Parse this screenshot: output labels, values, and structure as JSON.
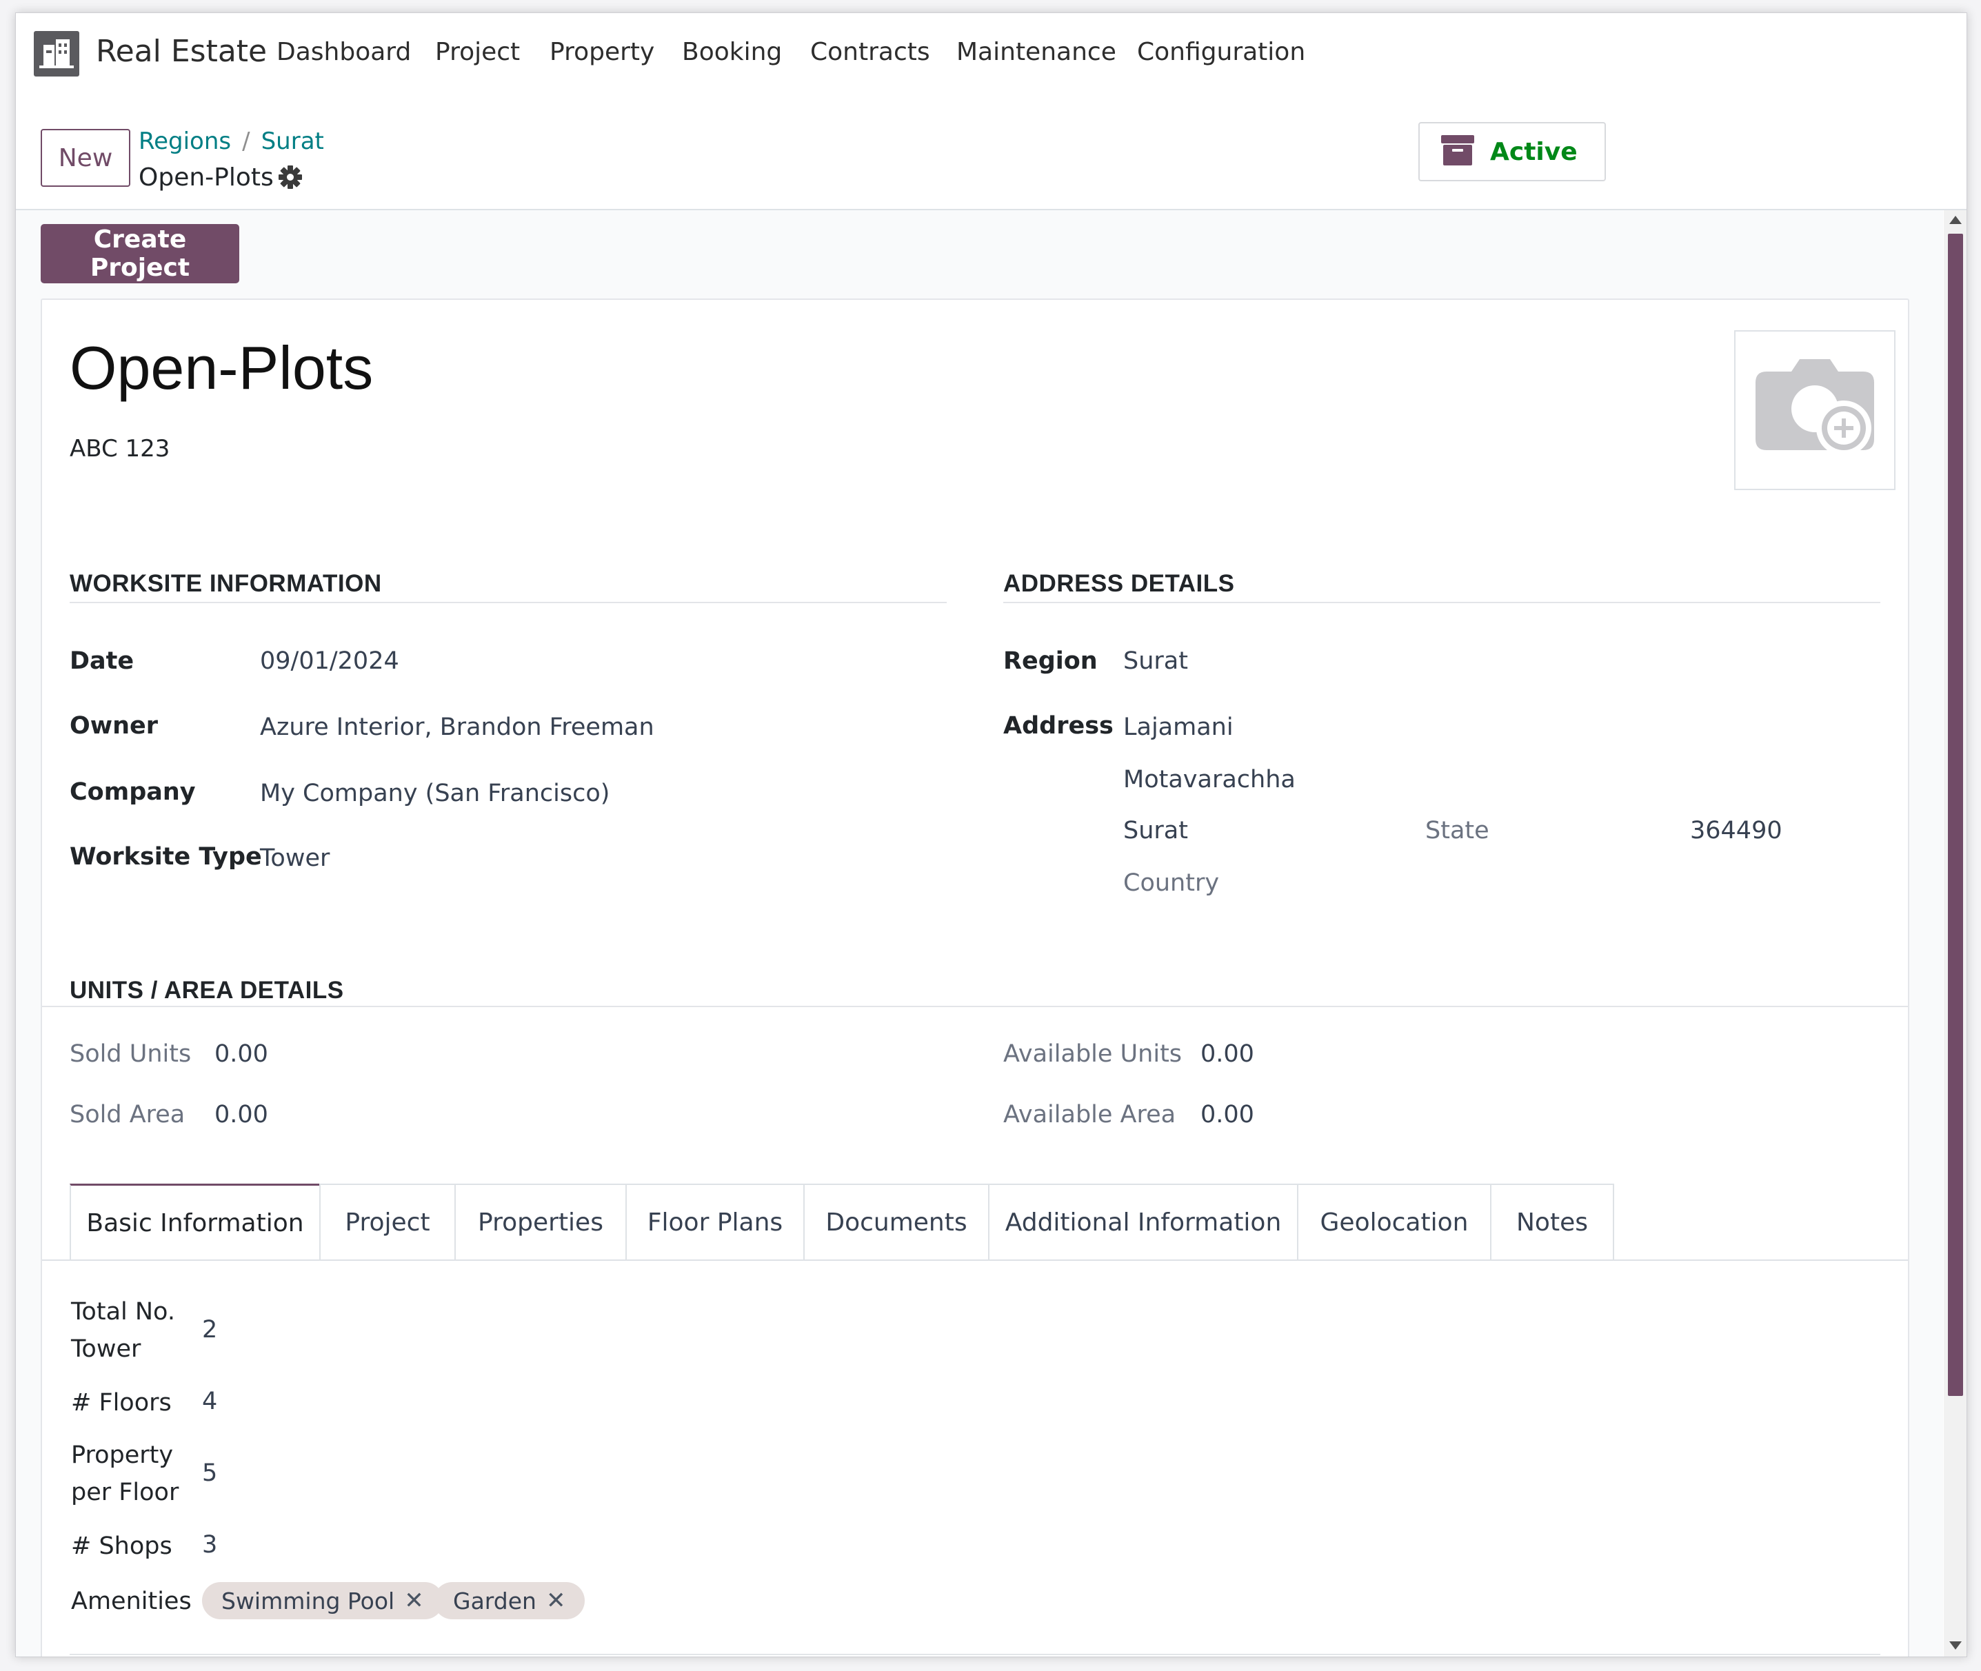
{
  "app": {
    "name": "Real Estate"
  },
  "nav": {
    "items": [
      {
        "label": "Dashboard"
      },
      {
        "label": "Project"
      },
      {
        "label": "Property"
      },
      {
        "label": "Booking"
      },
      {
        "label": "Contracts"
      },
      {
        "label": "Maintenance"
      },
      {
        "label": "Configuration"
      }
    ]
  },
  "control": {
    "new_label": "New",
    "breadcrumb": [
      "Regions",
      "Surat"
    ],
    "breadcrumb_sep": "/",
    "record_title": "Open-Plots",
    "active_label": "Active"
  },
  "actions": {
    "create_project_label": "Create Project"
  },
  "record": {
    "name": "Open-Plots",
    "reference": "ABC 123"
  },
  "worksite": {
    "title": "WORKSITE INFORMATION",
    "date_label": "Date",
    "date_value": "09/01/2024",
    "owner_label": "Owner",
    "owner_value": "Azure Interior, Brandon Freeman",
    "company_label": "Company",
    "company_value": "My Company (San Francisco)",
    "type_label": "Worksite Type",
    "type_value": "Tower"
  },
  "address": {
    "title": "ADDRESS DETAILS",
    "region_label": "Region",
    "region_value": "Surat",
    "address_label": "Address",
    "street": "Lajamani",
    "street2": "Motavarachha",
    "city": "Surat",
    "state_placeholder": "State",
    "zip": "364490",
    "country_placeholder": "Country"
  },
  "units": {
    "title": "UNITS / AREA DETAILS",
    "sold_units_label": "Sold Units",
    "sold_units_value": "0.00",
    "sold_area_label": "Sold Area",
    "sold_area_value": "0.00",
    "available_units_label": "Available Units",
    "available_units_value": "0.00",
    "available_area_label": "Available Area",
    "available_area_value": "0.00"
  },
  "tabs": [
    {
      "label": "Basic Information"
    },
    {
      "label": "Project"
    },
    {
      "label": "Properties"
    },
    {
      "label": "Floor Plans"
    },
    {
      "label": "Documents"
    },
    {
      "label": "Additional Information"
    },
    {
      "label": "Geolocation"
    },
    {
      "label": "Notes"
    }
  ],
  "basic": {
    "total_tower_label_1": "Total No.",
    "total_tower_label_2": "Tower",
    "total_tower_value": "2",
    "floors_label": "# Floors",
    "floors_value": "4",
    "ppf_label_1": "Property",
    "ppf_label_2": "per Floor",
    "ppf_value": "5",
    "shops_label": "# Shops",
    "shops_value": "3",
    "amenities_label": "Amenities",
    "amenities": [
      "Swimming Pool",
      "Garden"
    ]
  },
  "colors": {
    "brand": "#714b67",
    "link": "#017e84",
    "active": "#008818"
  },
  "icons": {
    "settings": "gear-icon",
    "archive": "archive-box-icon",
    "camera": "camera-add-icon"
  }
}
